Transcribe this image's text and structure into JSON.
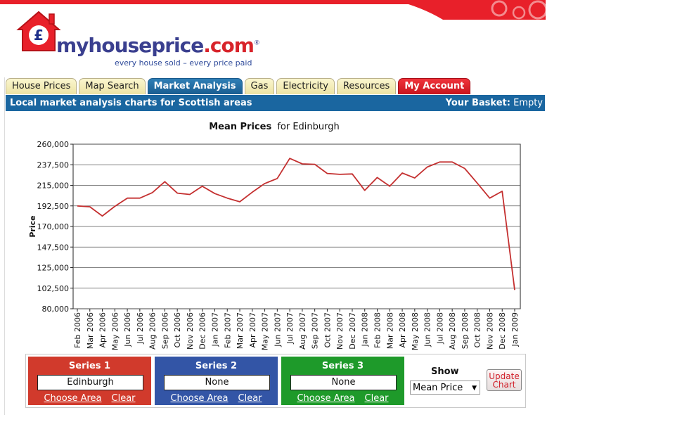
{
  "brand": {
    "name_main": "myhouseprice",
    "name_tld": ".com",
    "registered": "®",
    "tagline": "every house sold – every price paid",
    "red": "#e8202a",
    "blue": "#3a3f8f"
  },
  "nav": {
    "tabs": [
      {
        "label": "House Prices",
        "state": "default"
      },
      {
        "label": "Map Search",
        "state": "default"
      },
      {
        "label": "Market Analysis",
        "state": "active"
      },
      {
        "label": "Gas",
        "state": "default"
      },
      {
        "label": "Electricity",
        "state": "default"
      },
      {
        "label": "Resources",
        "state": "default"
      },
      {
        "label": "My Account",
        "state": "account"
      }
    ]
  },
  "subbar": {
    "title": "Local market analysis charts for Scottish areas",
    "basket_label": "Your Basket:",
    "basket_value": "Empty"
  },
  "chart_data": {
    "type": "line",
    "title_bold": "Mean Prices",
    "title_rest": "for Edinburgh",
    "xlabel": "",
    "ylabel": "Price",
    "ylim": [
      80000,
      260000
    ],
    "yticks": [
      "80,000",
      "102,500",
      "125,000",
      "147,500",
      "170,000",
      "192,500",
      "215,000",
      "237,500",
      "260,000"
    ],
    "grid": "horizontal",
    "categories": [
      "Feb 2006",
      "Mar 2006",
      "Apr 2006",
      "May 2006",
      "Jun 2006",
      "Jul 2006",
      "Aug 2006",
      "Sep 2006",
      "Oct 2006",
      "Nov 2006",
      "Dec 2006",
      "Jan 2007",
      "Feb 2007",
      "Mar 2007",
      "Apr 2007",
      "May 2007",
      "Jun 2007",
      "Jul 2007",
      "Aug 2007",
      "Sep 2007",
      "Oct 2007",
      "Nov 2007",
      "Dec 2007",
      "Jan 2008",
      "Feb 2008",
      "Mar 2008",
      "Apr 2008",
      "May 2008",
      "Jun 2008",
      "Jul 2008",
      "Aug 2008",
      "Sep 2008",
      "Oct 2008",
      "Nov 2008",
      "Dec 2008",
      "Jan 2009"
    ],
    "series": [
      {
        "name": "Edinburgh",
        "color": "#c43030",
        "values": [
          192500,
          191500,
          181500,
          192000,
          201000,
          201000,
          207000,
          219000,
          206500,
          205000,
          214000,
          206000,
          201000,
          197000,
          207500,
          217000,
          222500,
          244500,
          238500,
          238000,
          228000,
          227000,
          227500,
          209500,
          223500,
          214000,
          228500,
          223000,
          235000,
          240500,
          240500,
          233500,
          217500,
          201000,
          208500,
          100500
        ]
      }
    ]
  },
  "controls": {
    "series": [
      {
        "title": "Series 1",
        "value": "Edinburgh",
        "choose": "Choose Area",
        "clear": "Clear"
      },
      {
        "title": "Series 2",
        "value": "None",
        "choose": "Choose Area",
        "clear": "Clear"
      },
      {
        "title": "Series 3",
        "value": "None",
        "choose": "Choose Area",
        "clear": "Clear"
      }
    ],
    "show_label": "Show",
    "show_value": "Mean Price",
    "update_label_1": "Update",
    "update_label_2": "Chart"
  }
}
